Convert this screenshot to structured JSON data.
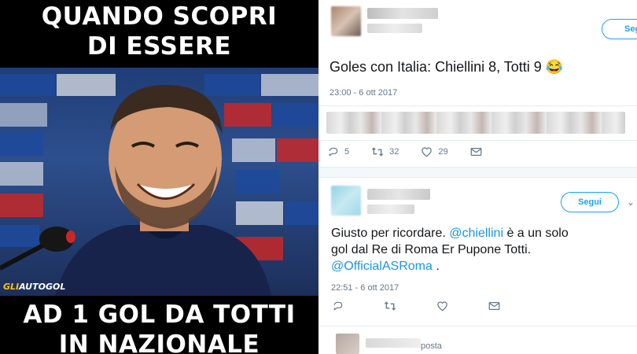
{
  "meme": {
    "top_text_line1": "QUANDO SCOPRI",
    "top_text_line2": "DI ESSERE",
    "bottom_text_line1": "AD 1 GOL DA TOTTI",
    "bottom_text_line2": "IN NAZIONALE",
    "watermark_part1": "GLI",
    "watermark_part2": "AUTOGOL"
  },
  "tweet1": {
    "follow_label": "Seg",
    "text": "Goles con Italia: Chiellini 8, Totti 9",
    "emoji": "😂",
    "timestamp": "23:00 - 6 ott 2017",
    "replies": "5",
    "retweets": "32",
    "likes": "29"
  },
  "tweet2": {
    "follow_label": "Segui",
    "text_line1_pre": "Giusto per ricordare. ",
    "mention1": "@chiellini",
    "text_line1_post": " è a un solo",
    "text_line2": "gol dal Re di Roma Er Pupone Totti.",
    "mention2": "@OfficialASRoma",
    "text_line3_post": " .",
    "timestamp": "22:51 - 6 ott 2017"
  },
  "tweet3": {
    "partial_text": "posta"
  },
  "colors": {
    "accent": "#1da1f2",
    "mention": "#1b95e0",
    "meta_gray": "#657786"
  }
}
